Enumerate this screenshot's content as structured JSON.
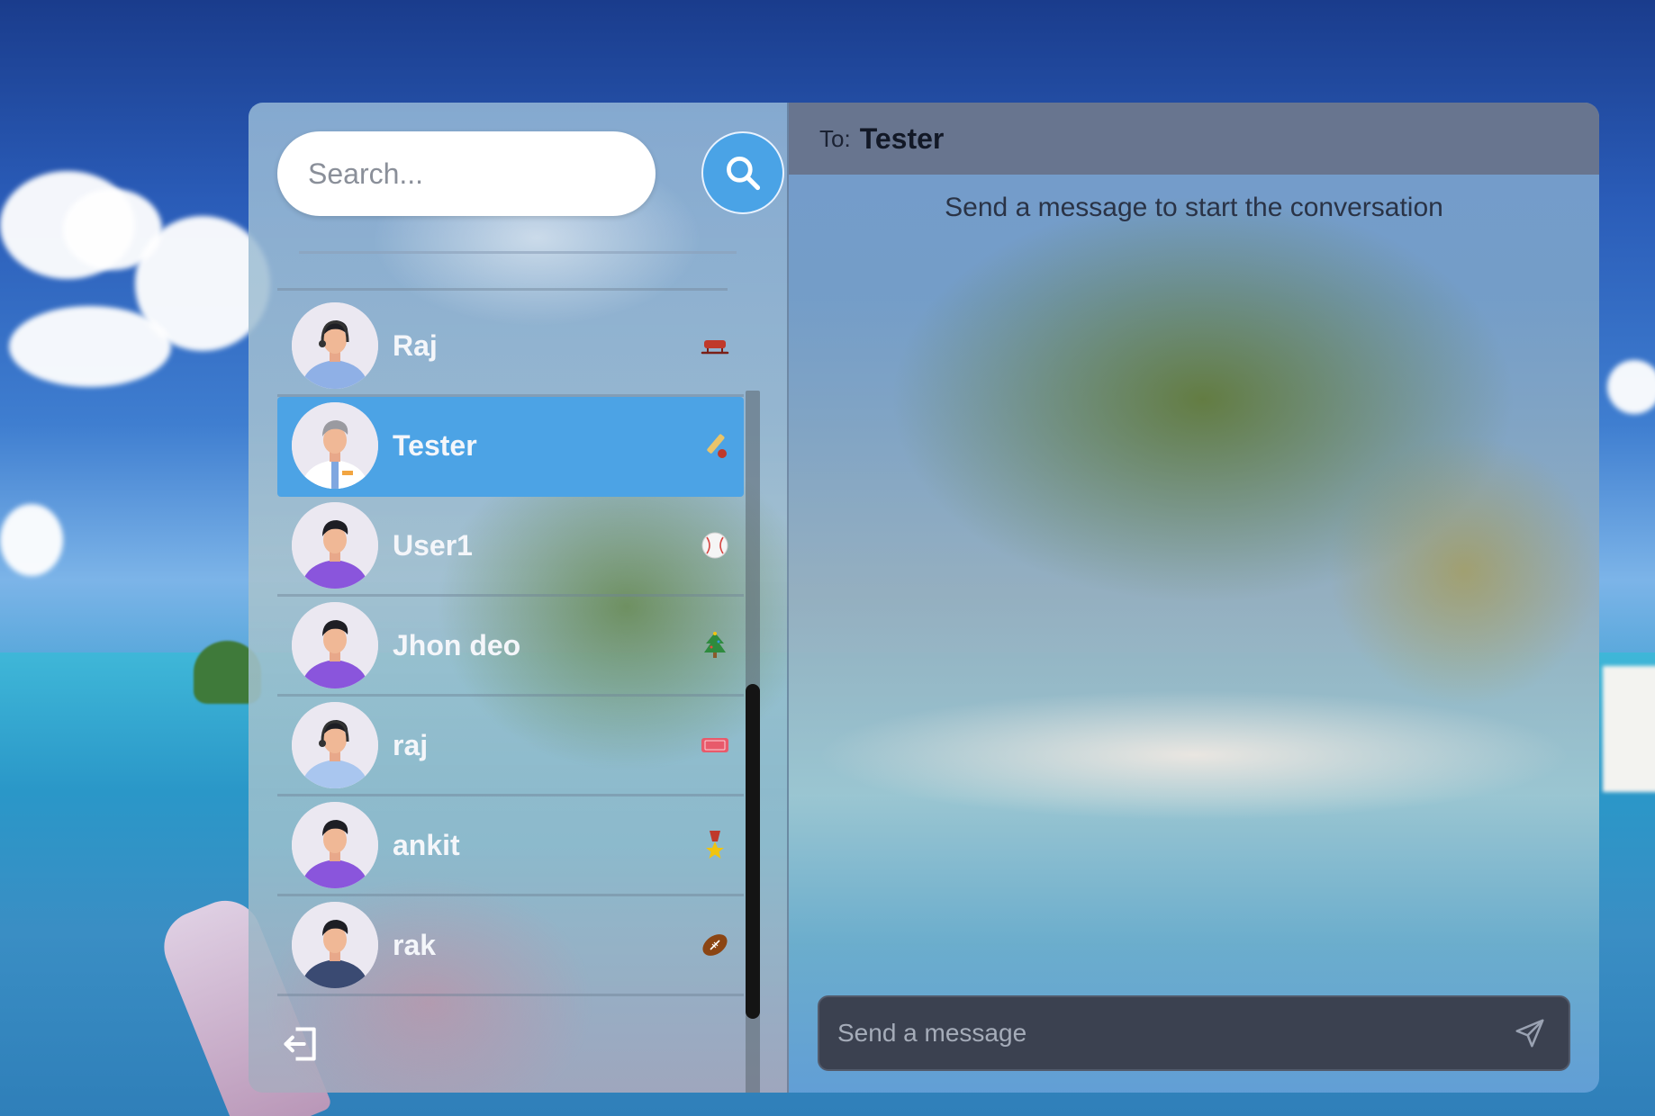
{
  "search": {
    "placeholder": "Search...",
    "button_icon": "search-icon"
  },
  "contacts": [
    {
      "name": "Raj",
      "avatar": "avatar-headset-man",
      "emoji": "sled-icon",
      "active": false
    },
    {
      "name": "Tester",
      "avatar": "avatar-grey-hair-man",
      "emoji": "cricket-icon",
      "active": true
    },
    {
      "name": "User1",
      "avatar": "avatar-purple-shirt-man",
      "emoji": "baseball-icon",
      "active": false
    },
    {
      "name": "Jhon deo",
      "avatar": "avatar-purple-shirt-man",
      "emoji": "christmas-tree-icon",
      "active": false
    },
    {
      "name": "raj",
      "avatar": "avatar-headset-man-blue",
      "emoji": "admit-ticket-icon",
      "active": false
    },
    {
      "name": "ankit",
      "avatar": "avatar-purple-shirt-man",
      "emoji": "military-medal-icon",
      "active": false
    },
    {
      "name": "rak",
      "avatar": "avatar-dark-shirt-man",
      "emoji": "football-icon",
      "active": false
    }
  ],
  "sidebar": {
    "logout_icon": "logout-icon"
  },
  "chat": {
    "to_label": "To:",
    "recipient": "Tester",
    "empty_message": "Send a message to start the conversation",
    "input_placeholder": "Send a message",
    "send_icon": "send-icon"
  },
  "colors": {
    "accent": "#4ca3e5",
    "header": "#68758f",
    "composer": "#3b4150"
  }
}
